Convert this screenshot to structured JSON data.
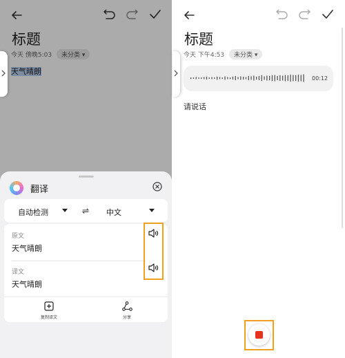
{
  "left_pane": {
    "note_title": "标题",
    "meta_date": "今天 傍晚5:03",
    "category": "未分类",
    "body_text": "天气晴朗"
  },
  "translate_panel": {
    "title": "翻译",
    "source_lang": "自动检测",
    "target_lang": "中文",
    "original_label": "原文",
    "original_text": "天气晴朗",
    "translated_label": "译文",
    "translated_text": "天气晴朗",
    "copy_label": "复制译文",
    "share_label": "分享",
    "swap_symbol": "⇌"
  },
  "right_pane": {
    "note_title": "标题",
    "meta_date": "今天 下午4:53",
    "category": "未分类",
    "voice_duration": "00:12",
    "prompt": "请说话"
  },
  "colors": {
    "highlight": "#f0a020",
    "record": "#e5331d",
    "text_selection": "#b9d3f3"
  },
  "icons": [
    "back-arrow-icon",
    "undo-icon",
    "redo-icon",
    "check-icon",
    "close-circle-icon",
    "caret-down-icon",
    "speaker-icon",
    "copy-icon",
    "share-icon",
    "chevron-right-icon",
    "stop-icon"
  ]
}
